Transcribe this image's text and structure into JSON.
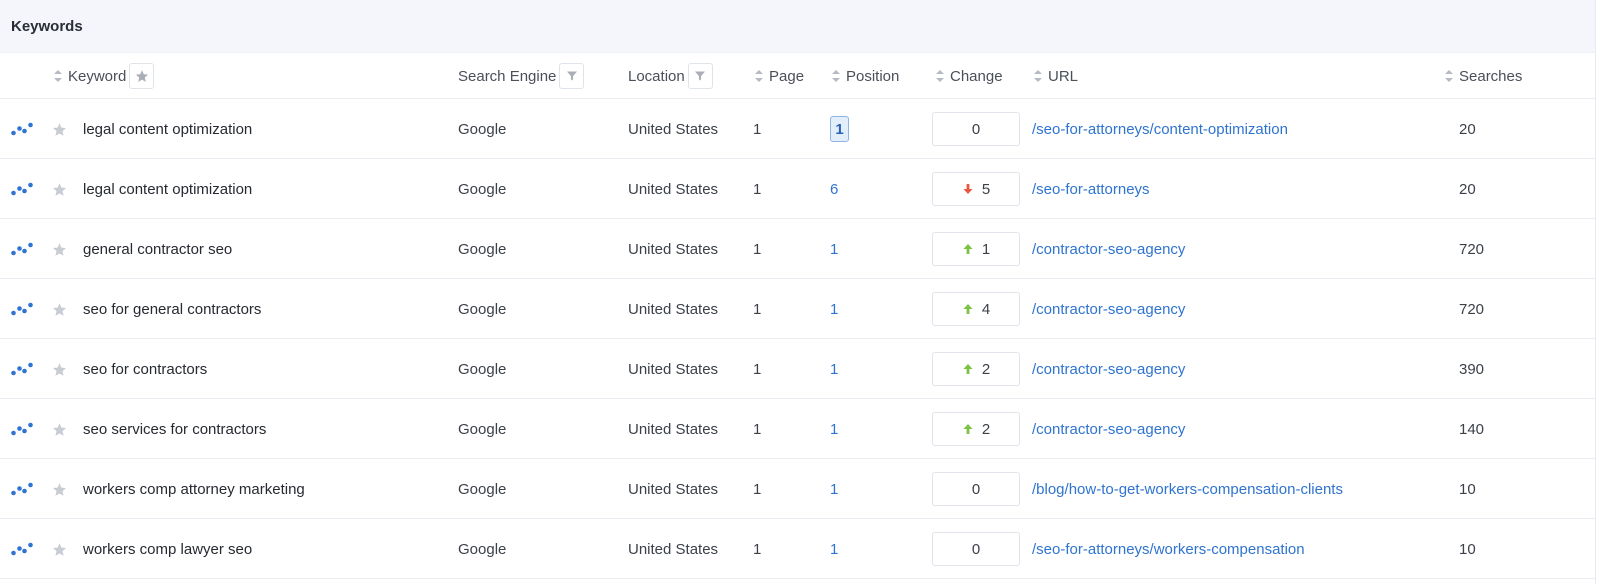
{
  "panel": {
    "title": "Keywords"
  },
  "columns": {
    "keyword": "Keyword",
    "search_engine": "Search Engine",
    "location": "Location",
    "page": "Page",
    "position": "Position",
    "change": "Change",
    "url": "URL",
    "searches": "Searches"
  },
  "colors": {
    "accent": "#2f74d0",
    "up": "#7cc243",
    "down": "#e8573f",
    "star": "#c8ccd3"
  },
  "rows": [
    {
      "keyword": "legal content optimization",
      "engine": "Google",
      "location": "United States",
      "page": "1",
      "position": "1",
      "position_highlight": true,
      "change": "0",
      "direction": "none",
      "url": "/seo-for-attorneys/content-optimization",
      "searches": "20"
    },
    {
      "keyword": "legal content optimization",
      "engine": "Google",
      "location": "United States",
      "page": "1",
      "position": "6",
      "position_highlight": false,
      "change": "5",
      "direction": "down",
      "url": "/seo-for-attorneys",
      "searches": "20"
    },
    {
      "keyword": "general contractor seo",
      "engine": "Google",
      "location": "United States",
      "page": "1",
      "position": "1",
      "position_highlight": false,
      "change": "1",
      "direction": "up",
      "url": "/contractor-seo-agency",
      "searches": "720"
    },
    {
      "keyword": "seo for general contractors",
      "engine": "Google",
      "location": "United States",
      "page": "1",
      "position": "1",
      "position_highlight": false,
      "change": "4",
      "direction": "up",
      "url": "/contractor-seo-agency",
      "searches": "720"
    },
    {
      "keyword": "seo for contractors",
      "engine": "Google",
      "location": "United States",
      "page": "1",
      "position": "1",
      "position_highlight": false,
      "change": "2",
      "direction": "up",
      "url": "/contractor-seo-agency",
      "searches": "390"
    },
    {
      "keyword": "seo services for contractors",
      "engine": "Google",
      "location": "United States",
      "page": "1",
      "position": "1",
      "position_highlight": false,
      "change": "2",
      "direction": "up",
      "url": "/contractor-seo-agency",
      "searches": "140"
    },
    {
      "keyword": "workers comp attorney marketing",
      "engine": "Google",
      "location": "United States",
      "page": "1",
      "position": "1",
      "position_highlight": false,
      "change": "0",
      "direction": "none",
      "url": "/blog/how-to-get-workers-compensation-clients",
      "searches": "10"
    },
    {
      "keyword": "workers comp lawyer seo",
      "engine": "Google",
      "location": "United States",
      "page": "1",
      "position": "1",
      "position_highlight": false,
      "change": "0",
      "direction": "none",
      "url": "/seo-for-attorneys/workers-compensation",
      "searches": "10"
    }
  ]
}
